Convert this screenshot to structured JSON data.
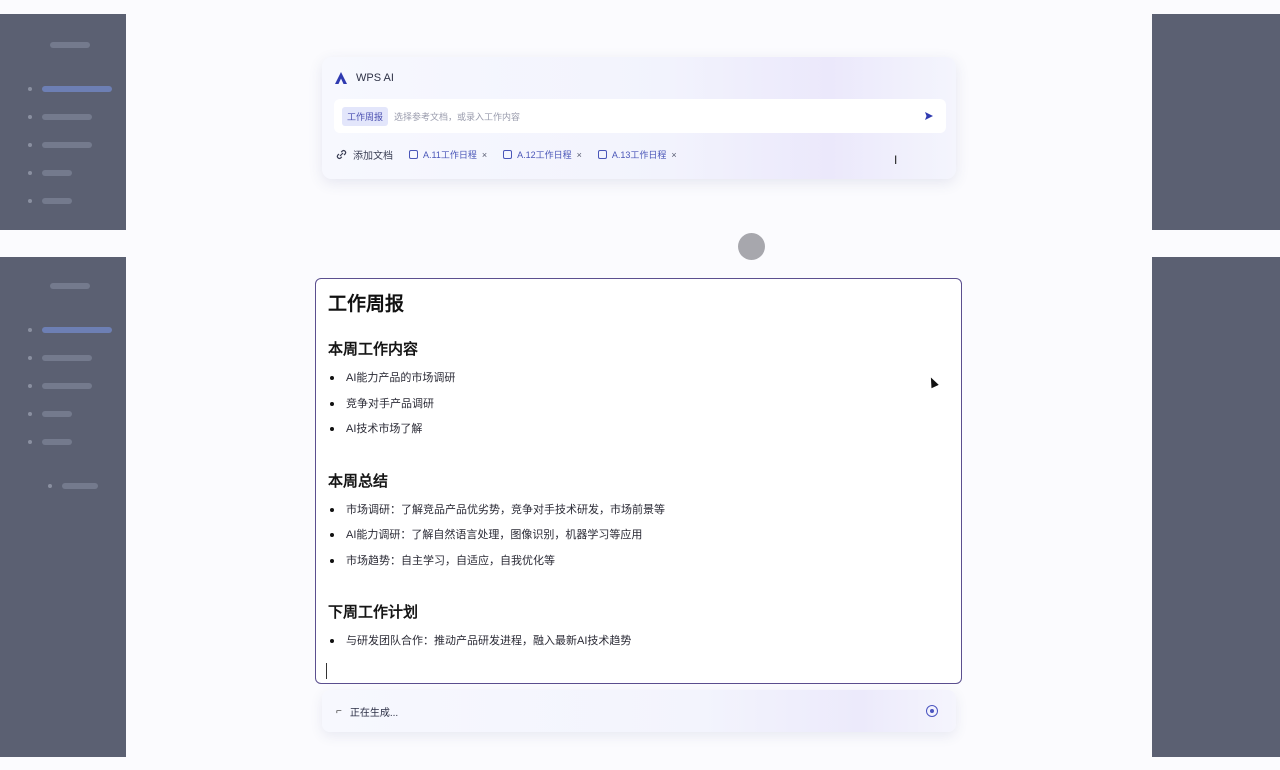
{
  "ai_panel": {
    "title": "WPS AI",
    "input_tag": "工作周报",
    "input_placeholder": "选择参考文档，或录入工作内容",
    "add_doc_label": "添加文档",
    "attached_files": [
      "A.11工作日程",
      "A.12工作日程",
      "A.13工作日程"
    ],
    "remove_symbol": "×"
  },
  "document": {
    "title": "工作周报",
    "sections": [
      {
        "heading": "本周工作内容",
        "items": [
          "AI能力产品的市场调研",
          "竞争对手产品调研",
          "AI技术市场了解"
        ]
      },
      {
        "heading": "本周总结",
        "items": [
          "市场调研：了解竞品产品优劣势，竞争对手技术研发，市场前景等",
          "AI能力调研：了解自然语言处理，图像识别，机器学习等应用",
          "市场趋势：自主学习，自适应，自我优化等"
        ]
      },
      {
        "heading": "下周工作计划",
        "items": [
          "与研发团队合作：推动产品研发进程，融入最新AI技术趋势"
        ]
      }
    ]
  },
  "status_bar": {
    "text": "正在生成..."
  },
  "colors": {
    "accent": "#4b55c0",
    "editor_border": "#5b4f8f",
    "side_panel": "#5b6072"
  }
}
